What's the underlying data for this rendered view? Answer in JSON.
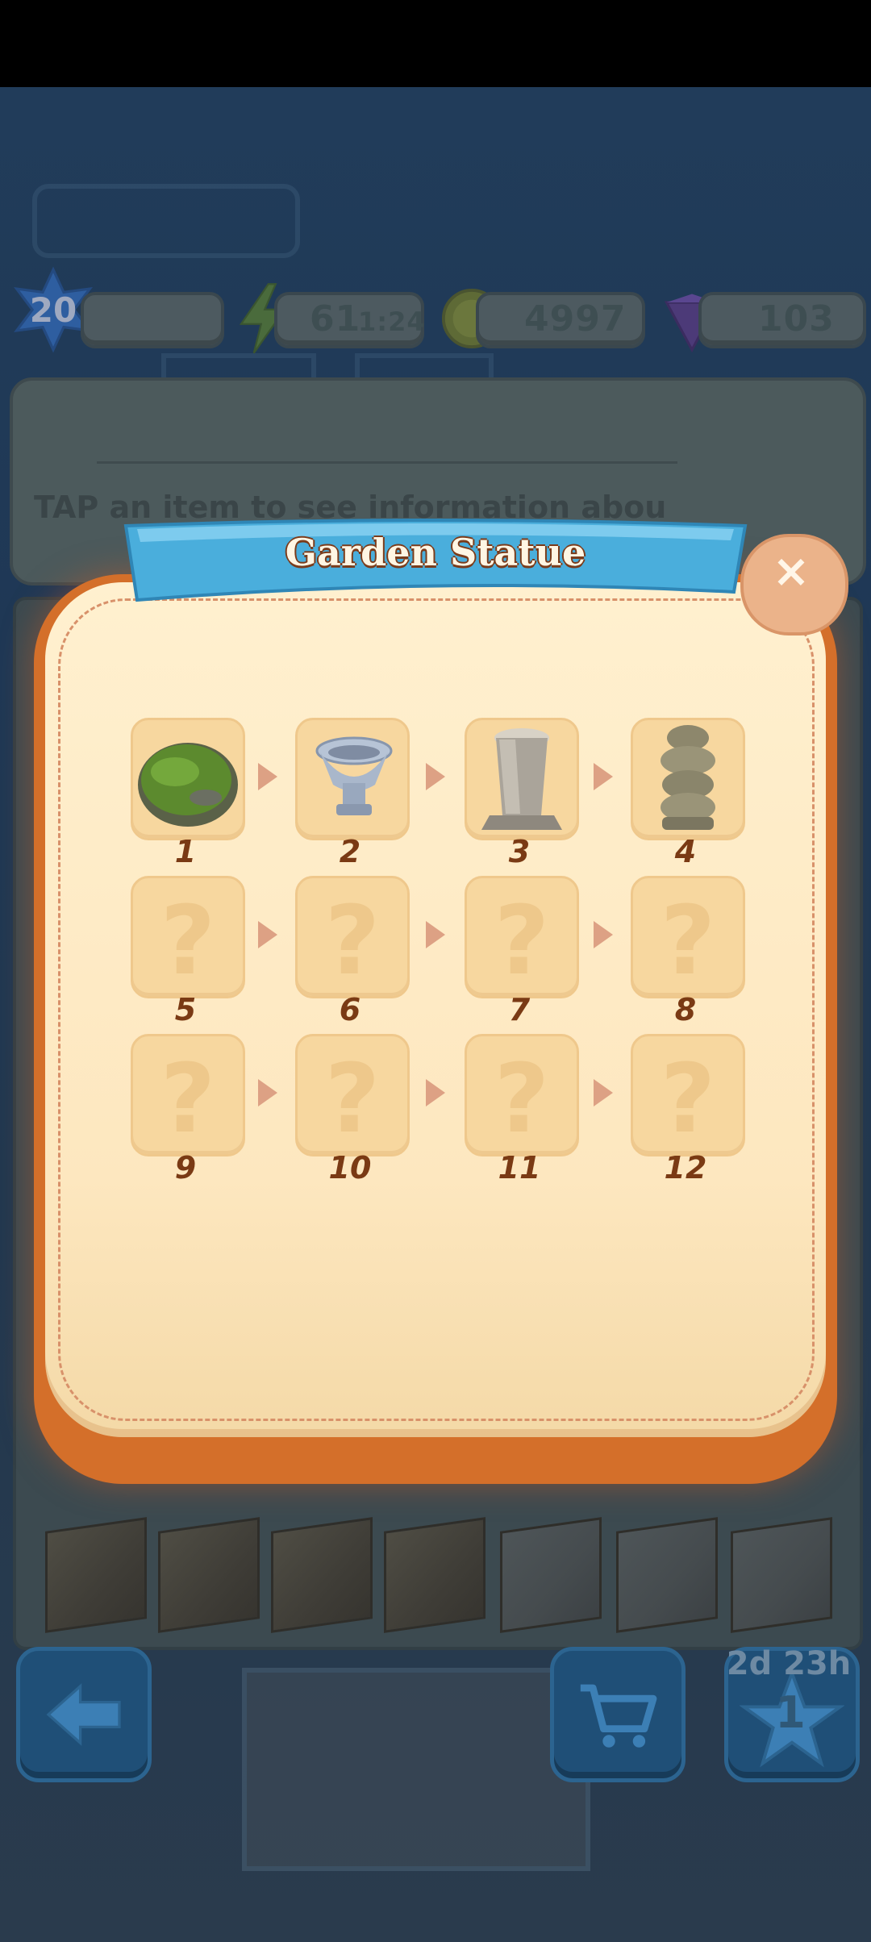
{
  "hud": {
    "level": "20",
    "energy": "61",
    "energy_timer": "1:24",
    "coins": "4997",
    "gems": "103"
  },
  "info_panel": {
    "text": "TAP an item to see information abou"
  },
  "bottom_bar": {
    "event_timer": "2d 23h",
    "event_count": "1"
  },
  "modal": {
    "title": "Garden Statue",
    "close_label": "×",
    "items": [
      {
        "number": "1",
        "state": "unlocked",
        "icon": "mossy-rock-icon"
      },
      {
        "number": "2",
        "state": "unlocked",
        "icon": "stone-urn-icon"
      },
      {
        "number": "3",
        "state": "unlocked",
        "icon": "stone-pillar-icon"
      },
      {
        "number": "4",
        "state": "unlocked",
        "icon": "rough-statue-icon"
      },
      {
        "number": "5",
        "state": "locked",
        "icon": "question-mark-icon",
        "glyph": "?"
      },
      {
        "number": "6",
        "state": "locked",
        "icon": "question-mark-icon",
        "glyph": "?"
      },
      {
        "number": "7",
        "state": "locked",
        "icon": "question-mark-icon",
        "glyph": "?"
      },
      {
        "number": "8",
        "state": "locked",
        "icon": "question-mark-icon",
        "glyph": "?"
      },
      {
        "number": "9",
        "state": "locked",
        "icon": "question-mark-icon",
        "glyph": "?"
      },
      {
        "number": "10",
        "state": "locked",
        "icon": "question-mark-icon",
        "glyph": "?"
      },
      {
        "number": "11",
        "state": "locked",
        "icon": "question-mark-icon",
        "glyph": "?"
      },
      {
        "number": "12",
        "state": "locked",
        "icon": "question-mark-icon",
        "glyph": "?"
      }
    ]
  },
  "colors": {
    "modal_frame": "#d46f2a",
    "modal_fill": "#fde7bf",
    "banner": "#4aaedc",
    "item_number": "#7a3a14"
  }
}
